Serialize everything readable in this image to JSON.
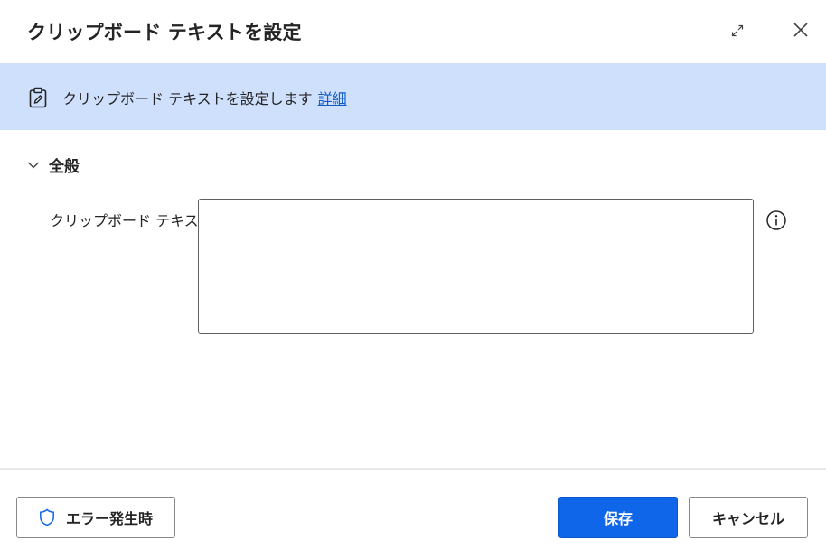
{
  "dialog": {
    "title": "クリップボード テキストを設定"
  },
  "banner": {
    "text": "クリップボード テキストを設定します",
    "link_label": "詳細"
  },
  "section": {
    "title": "全般"
  },
  "field": {
    "label": "クリップボード テキスト:",
    "value": ""
  },
  "footer": {
    "error_button_label": "エラー発生時",
    "save_label": "保存",
    "cancel_label": "キャンセル"
  },
  "colors": {
    "banner_bg": "#cfe0fc",
    "link": "#0f5dc7",
    "primary": "#0f66e8",
    "border": "#5f5f5f"
  },
  "icons": [
    "expand-icon",
    "close-icon",
    "clipboard-icon",
    "chevron-down-icon",
    "info-icon",
    "shield-icon"
  ]
}
